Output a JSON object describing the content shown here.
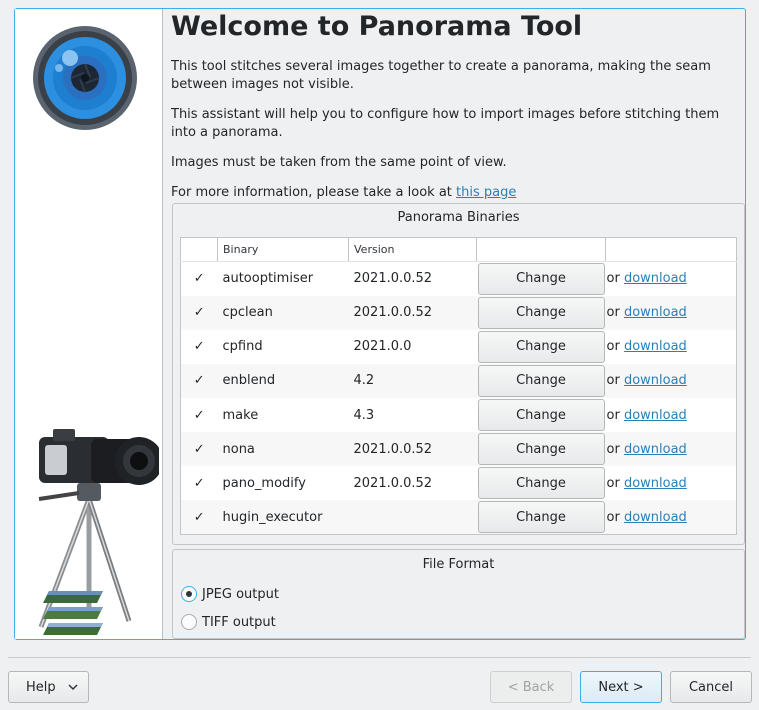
{
  "title": "Welcome to Panorama Tool",
  "paragraphs": {
    "p1": "This tool stitches several images together to create a panorama, making the seam between images not visible.",
    "p2": "This assistant will help you to configure how to import images before stitching them into a panorama.",
    "p3": "Images must be taken from the same point of view.",
    "p4_prefix": "For more information, please take a look at ",
    "p4_link": "this page"
  },
  "binaries": {
    "group_title": "Panorama Binaries",
    "columns": [
      "",
      "Binary",
      "Version",
      "",
      ""
    ],
    "change_label": "Change",
    "or_label": "or ",
    "download_label": "download",
    "rows": [
      {
        "found": "✓",
        "binary": "autooptimiser",
        "version": "2021.0.0.52"
      },
      {
        "found": "✓",
        "binary": "cpclean",
        "version": "2021.0.0.52"
      },
      {
        "found": "✓",
        "binary": "cpfind",
        "version": "2021.0.0"
      },
      {
        "found": "✓",
        "binary": "enblend",
        "version": "4.2"
      },
      {
        "found": "✓",
        "binary": "make",
        "version": "4.3"
      },
      {
        "found": "✓",
        "binary": "nona",
        "version": "2021.0.0.52"
      },
      {
        "found": "✓",
        "binary": "pano_modify",
        "version": "2021.0.0.52"
      },
      {
        "found": "✓",
        "binary": "hugin_executor",
        "version": ""
      }
    ]
  },
  "file_format": {
    "group_title": "File Format",
    "options": [
      {
        "label": "JPEG output",
        "selected": true
      },
      {
        "label": "TIFF output",
        "selected": false
      }
    ]
  },
  "buttons": {
    "help": "Help",
    "back": "< Back",
    "next": "Next >",
    "cancel": "Cancel"
  },
  "icons": {
    "logo": "panorama-lens-icon",
    "side_image": "camera-tripod-illustration",
    "check": "check-icon",
    "help_menu": "chevron-down-icon"
  },
  "colors": {
    "accent": "#3daee9",
    "link": "#2980b9",
    "logo_blue": "#1e7fd0"
  }
}
